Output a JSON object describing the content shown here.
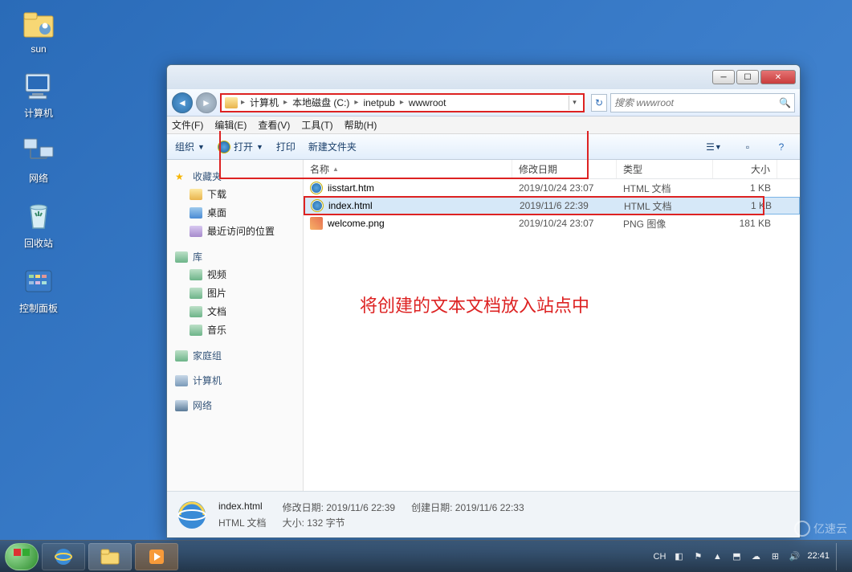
{
  "desktop_icons": {
    "sun": "sun",
    "computer": "计算机",
    "network": "网络",
    "recycle": "回收站",
    "control_panel": "控制面板"
  },
  "window": {
    "nav": {
      "breadcrumb": [
        "计算机",
        "本地磁盘 (C:)",
        "inetpub",
        "wwwroot"
      ],
      "search_placeholder": "搜索 wwwroot"
    },
    "menu": {
      "file": "文件(F)",
      "edit": "编辑(E)",
      "view": "查看(V)",
      "tools": "工具(T)",
      "help": "帮助(H)"
    },
    "toolbar": {
      "organize": "组织",
      "open": "打开",
      "print": "打印",
      "new_folder": "新建文件夹"
    },
    "sidebar": {
      "favorites": "收藏夹",
      "downloads": "下载",
      "desktop": "桌面",
      "recent": "最近访问的位置",
      "libraries": "库",
      "videos": "视频",
      "pictures": "图片",
      "documents": "文档",
      "music": "音乐",
      "homegroup": "家庭组",
      "computer": "计算机",
      "network": "网络"
    },
    "columns": {
      "name": "名称",
      "date": "修改日期",
      "type": "类型",
      "size": "大小"
    },
    "files": [
      {
        "name": "iisstart.htm",
        "date": "2019/10/24 23:07",
        "type": "HTML 文档",
        "size": "1 KB",
        "icon": "html"
      },
      {
        "name": "index.html",
        "date": "2019/11/6 22:39",
        "type": "HTML 文档",
        "size": "1 KB",
        "icon": "html"
      },
      {
        "name": "welcome.png",
        "date": "2019/10/24 23:07",
        "type": "PNG 图像",
        "size": "181 KB",
        "icon": "png"
      }
    ],
    "annotation": "将创建的文本文档放入站点中",
    "details": {
      "filename": "index.html",
      "filetype": "HTML 文档",
      "mod_label": "修改日期:",
      "mod_value": "2019/11/6 22:39",
      "size_label": "大小:",
      "size_value": "132 字节",
      "create_label": "创建日期:",
      "create_value": "2019/11/6 22:33"
    }
  },
  "taskbar": {
    "lang": "CH",
    "time": "22:41"
  },
  "watermark": "亿速云"
}
